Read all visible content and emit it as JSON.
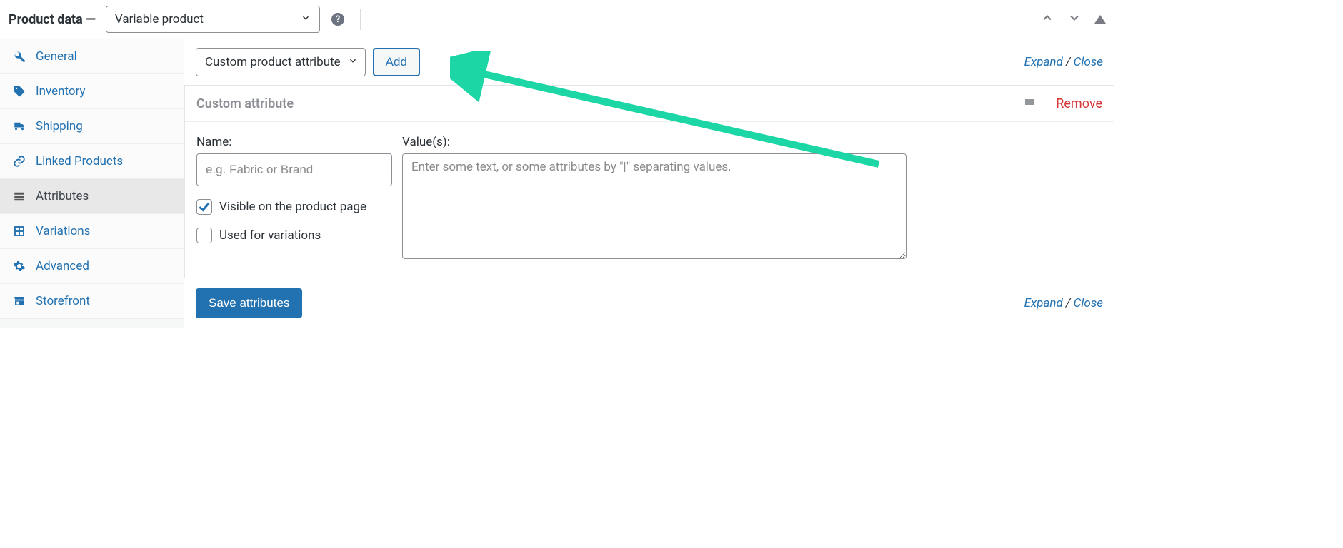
{
  "header": {
    "title": "Product data —",
    "product_type": "Variable product"
  },
  "sidebar": {
    "items": [
      {
        "label": "General"
      },
      {
        "label": "Inventory"
      },
      {
        "label": "Shipping"
      },
      {
        "label": "Linked Products"
      },
      {
        "label": "Attributes"
      },
      {
        "label": "Variations"
      },
      {
        "label": "Advanced"
      },
      {
        "label": "Storefront"
      }
    ]
  },
  "toolbar": {
    "attribute_type": "Custom product attribute",
    "add_label": "Add",
    "expand": "Expand",
    "close": "Close"
  },
  "attribute_card": {
    "title": "Custom attribute",
    "remove": "Remove",
    "name_label": "Name:",
    "name_placeholder": "e.g. Fabric or Brand",
    "values_label": "Value(s):",
    "values_placeholder": "Enter some text, or some attributes by \"|\" separating values.",
    "visible_label": "Visible on the product page",
    "used_label": "Used for variations"
  },
  "footer": {
    "save_label": "Save attributes",
    "expand": "Expand",
    "close": "Close"
  }
}
